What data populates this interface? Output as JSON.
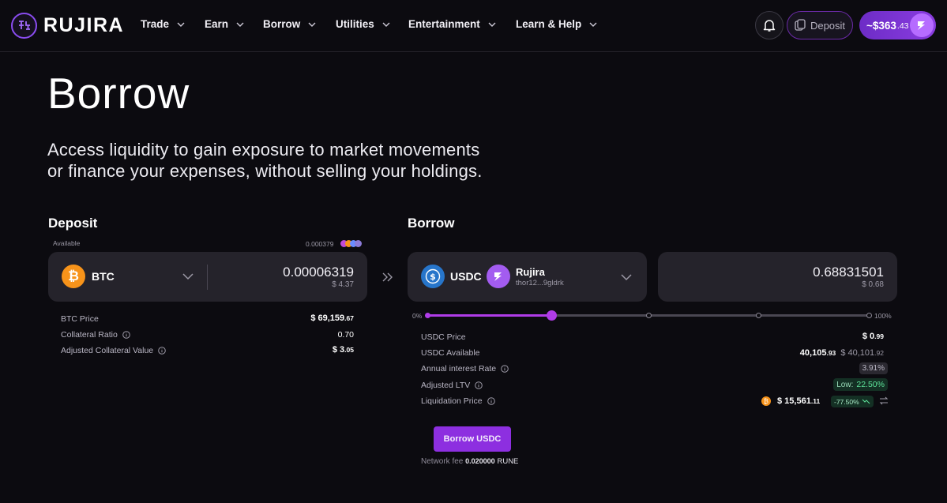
{
  "nav": {
    "logo_text": "RUJIRA",
    "items": [
      {
        "label": "Trade"
      },
      {
        "label": "Earn"
      },
      {
        "label": "Borrow"
      },
      {
        "label": "Utilities"
      },
      {
        "label": "Entertainment"
      },
      {
        "label": "Learn & Help"
      }
    ],
    "deposit_label": "Deposit",
    "balance_main": "~$363",
    "balance_cents": ".43"
  },
  "hero": {
    "title": "Borrow",
    "subtitle_line1": "Access liquidity to gain exposure to market movements",
    "subtitle_line2": "or finance your expenses, without selling your holdings."
  },
  "deposit": {
    "title": "Deposit",
    "available_label": "Available",
    "available_value": "0.000379",
    "asset": {
      "symbol": "BTC",
      "icon": "bitcoin-icon",
      "color": "#f7931a"
    },
    "amount": "0.00006319",
    "amount_usd": "$ 4.37",
    "stats": [
      {
        "label": "BTC Price",
        "value_main": "$ 69,159",
        "value_small": ".67",
        "info": false
      },
      {
        "label": "Collateral Ratio",
        "value_main": "0.70",
        "value_small": "",
        "info": true
      },
      {
        "label": "Adjusted Collateral Value",
        "value_main": "$ 3",
        "value_small": ".05",
        "info": true
      }
    ]
  },
  "borrow": {
    "title": "Borrow",
    "asset": {
      "symbol": "USDC",
      "icon": "usdc-icon",
      "color": "#2775ca"
    },
    "account": {
      "name": "Rujira",
      "address": "thor12...9gldrk"
    },
    "amount": "0.68831501",
    "amount_usd": "$ 0.68",
    "slider": {
      "min_label": "0%",
      "max_label": "100%",
      "value_pct": 28
    },
    "stats": [
      {
        "label": "USDC Price",
        "info": false
      },
      {
        "label": "USDC Available",
        "info": false
      },
      {
        "label": "Annual interest Rate",
        "info": true
      },
      {
        "label": "Adjusted LTV",
        "info": true
      },
      {
        "label": "Liquidation Price",
        "info": true
      }
    ],
    "usdc_price_main": "$ 0",
    "usdc_price_small": ".99",
    "available_main": "40,105",
    "available_small": ".93",
    "available_usd_main": "$ 40,101",
    "available_usd_small": ".92",
    "interest_rate": "3.91%",
    "ltv_label": "Low:",
    "ltv_value": "22.50%",
    "liq_price_main": "$ 15,561",
    "liq_price_small": ".11",
    "liq_change": "-77.50%",
    "button_label": "Borrow USDC",
    "fee_label": "Network fee",
    "fee_value": "0.020000",
    "fee_unit": "RUNE"
  },
  "colors": {
    "accent": "#8d2fe0",
    "card": "#25232b",
    "background": "#0c0b10",
    "positive": "#5ee39a"
  }
}
